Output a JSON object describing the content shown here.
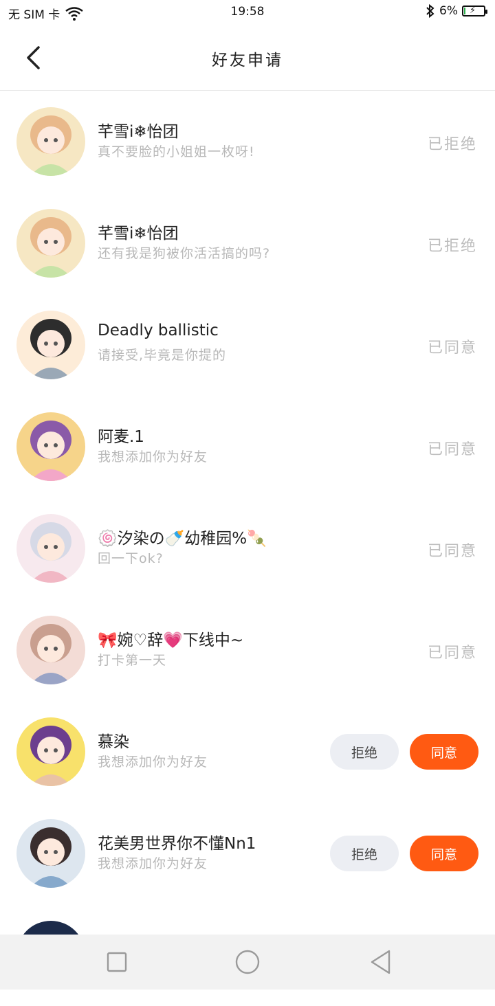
{
  "status_bar": {
    "carrier": "无 SIM 卡",
    "time": "19:58",
    "battery_percent": "6%",
    "battery_level": 0.06
  },
  "header": {
    "title": "好友申请"
  },
  "requests": [
    {
      "name": "芊雪i❄怡团",
      "message": "真不要脸的小姐姐一枚呀!",
      "status": "已拒绝",
      "avatar_colors": [
        "#f6e7c3",
        "#e9b98b",
        "#c7e3a6"
      ]
    },
    {
      "name": "芊雪i❄怡团",
      "message": "还有我是狗被你活活搞的吗?",
      "status": "已拒绝",
      "avatar_colors": [
        "#f6e7c3",
        "#e9b98b",
        "#c7e3a6"
      ]
    },
    {
      "name": "Deadly ballistic",
      "message": "请接受,毕竟是你提的",
      "status": "已同意",
      "avatar_colors": [
        "#fdecd8",
        "#2d2d2d",
        "#9aa8b6"
      ]
    },
    {
      "name": "阿麦.1",
      "message": "我想添加你为好友",
      "status": "已同意",
      "avatar_colors": [
        "#f6d48a",
        "#8a5aa8",
        "#f3a7c8"
      ]
    },
    {
      "name": "🍥汐染の🍼幼稚园%🍡",
      "message": "回一下ok?",
      "status": "已同意",
      "avatar_colors": [
        "#f7e9ee",
        "#d6d9e6",
        "#f1b7c4"
      ]
    },
    {
      "name": "🎀婉♡辞💗下线中~",
      "message": "打卡第一天",
      "status": "已同意",
      "avatar_colors": [
        "#f3dcd6",
        "#c99f8f",
        "#9aa4c6"
      ]
    },
    {
      "name": "慕染",
      "message": "我想添加你为好友",
      "status": "",
      "reject_label": "拒绝",
      "accept_label": "同意",
      "avatar_colors": [
        "#f8e16b",
        "#6c3e8e",
        "#e9c2a5"
      ]
    },
    {
      "name": "花美男世界你不懂Nn1",
      "message": "我想添加你为好友",
      "status": "",
      "reject_label": "拒绝",
      "accept_label": "同意",
      "avatar_colors": [
        "#dde6ef",
        "#3a2e2e",
        "#86a9cc"
      ]
    }
  ],
  "colors": {
    "accent": "#ff5a12",
    "reject_bg": "#eceef3",
    "muted_text": "#bdbdbd"
  },
  "nav": {
    "icons": [
      "recents-icon",
      "home-icon",
      "back-icon"
    ]
  }
}
